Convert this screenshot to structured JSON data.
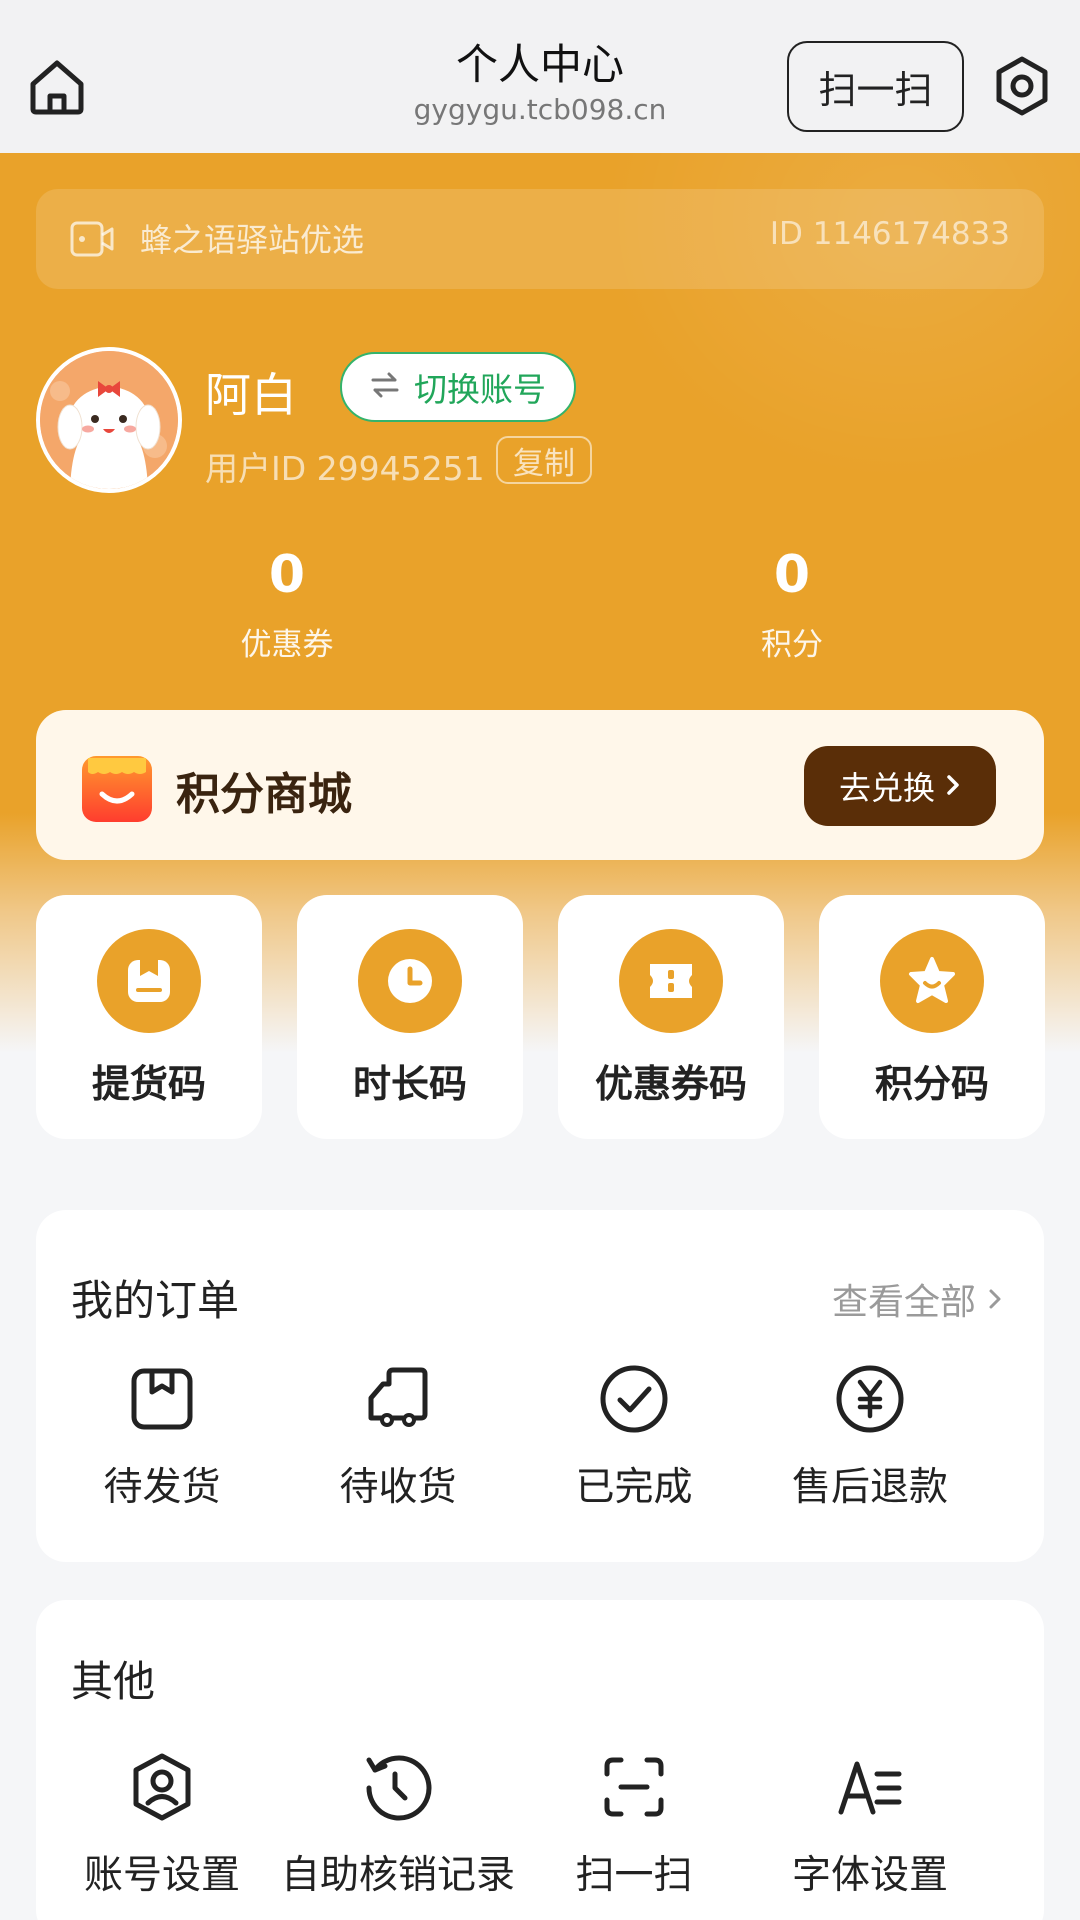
{
  "header": {
    "title": "个人中心",
    "domain": "gygygu.tcb098.cn",
    "scan_label": "扫一扫"
  },
  "shop": {
    "name": "蜂之语驿站优选",
    "id": "ID 1146174833"
  },
  "user": {
    "name": "阿白",
    "switch_label": "切换账号",
    "user_id": "用户ID 29945251",
    "copy_label": "复制"
  },
  "stats": [
    {
      "value": "0",
      "label": "优惠券"
    },
    {
      "value": "0",
      "label": "积分"
    }
  ],
  "mall": {
    "title": "积分商城",
    "button_label": "去兑换"
  },
  "codes": [
    {
      "label": "提货码",
      "icon": "package-icon"
    },
    {
      "label": "时长码",
      "icon": "clock-icon"
    },
    {
      "label": "优惠券码",
      "icon": "ticket-icon"
    },
    {
      "label": "积分码",
      "icon": "star-icon"
    }
  ],
  "orders": {
    "title": "我的订单",
    "view_all": "查看全部",
    "items": [
      {
        "label": "待发货",
        "icon": "box-icon"
      },
      {
        "label": "待收货",
        "icon": "truck-icon"
      },
      {
        "label": "已完成",
        "icon": "check-circle-icon"
      },
      {
        "label": "售后退款",
        "icon": "yuan-circle-icon"
      }
    ]
  },
  "other": {
    "title": "其他",
    "items": [
      {
        "label": "账号设置",
        "icon": "user-shield-icon"
      },
      {
        "label": "自助核销记录",
        "icon": "history-icon"
      },
      {
        "label": "扫一扫",
        "icon": "scan-icon"
      },
      {
        "label": "字体设置",
        "icon": "font-icon"
      }
    ]
  },
  "colors": {
    "accent": "#e9a22a",
    "switch_green": "#21a65a",
    "mall_button": "#5a2e08"
  }
}
